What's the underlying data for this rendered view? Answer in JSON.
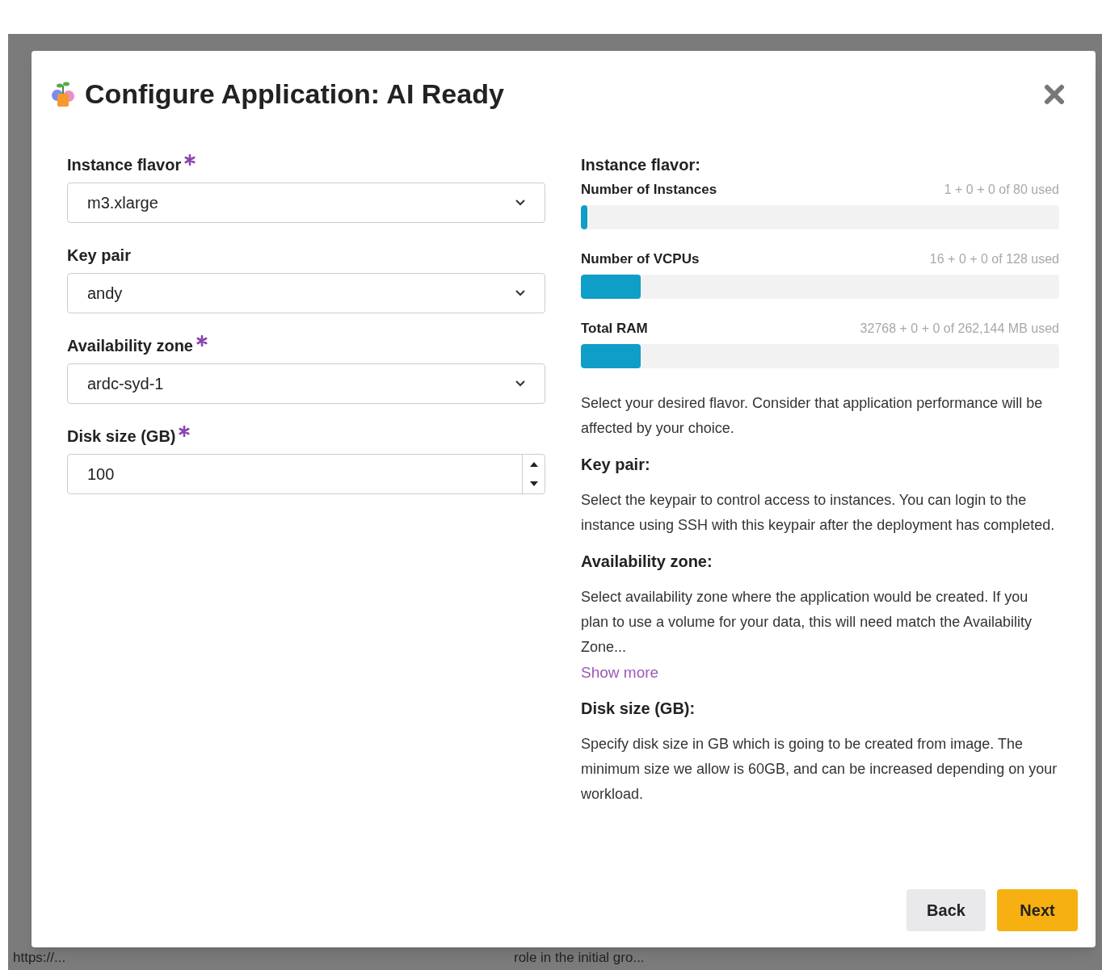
{
  "page": {
    "bottom_fragments": [
      "https://...",
      "role in the initial gro..."
    ]
  },
  "dialog": {
    "title": "Configure Application: AI Ready",
    "fields": [
      {
        "kind": "select",
        "label": "Instance flavor",
        "required": true,
        "value": "m3.xlarge"
      },
      {
        "kind": "select",
        "label": "Key pair",
        "required": false,
        "value": "andy"
      },
      {
        "kind": "select",
        "label": "Availability zone",
        "required": true,
        "value": "ardc-syd-1"
      },
      {
        "kind": "number",
        "label": "Disk size (GB)",
        "required": true,
        "value": "100"
      }
    ],
    "quota_title": "Instance flavor:",
    "quotas": [
      {
        "label": "Number of Instances",
        "reading": "1 + 0 + 0 of 80 used",
        "level": 0.0125
      },
      {
        "label": "Number of VCPUs",
        "reading": "16 + 0 + 0 of 128 used",
        "level": 0.125
      },
      {
        "label": "Total RAM",
        "reading": "32768 + 0 + 0 of 262,144 MB used",
        "level": 0.125
      }
    ],
    "help": [
      {
        "text": "Select your desired flavor. Consider that application performance will be affected by your choice."
      },
      {
        "heading": "Key pair:",
        "text": "Select the keypair to control access to instances. You can login to the instance using SSH with this keypair after the deployment has completed."
      },
      {
        "heading": "Availability zone:",
        "text": "Select availability zone where the application would be created. If you plan to use a volume for your data, this will need match the Availability Zone...",
        "link": "Show more"
      },
      {
        "heading": "Disk size (GB):",
        "text": "Specify disk size in GB which is going to be created from image. The minimum size we allow is 60GB, and can be increased depending on your workload."
      }
    ],
    "buttons": [
      {
        "label": "Back",
        "kind": "secondary"
      },
      {
        "label": "Next",
        "kind": "primary"
      }
    ]
  }
}
